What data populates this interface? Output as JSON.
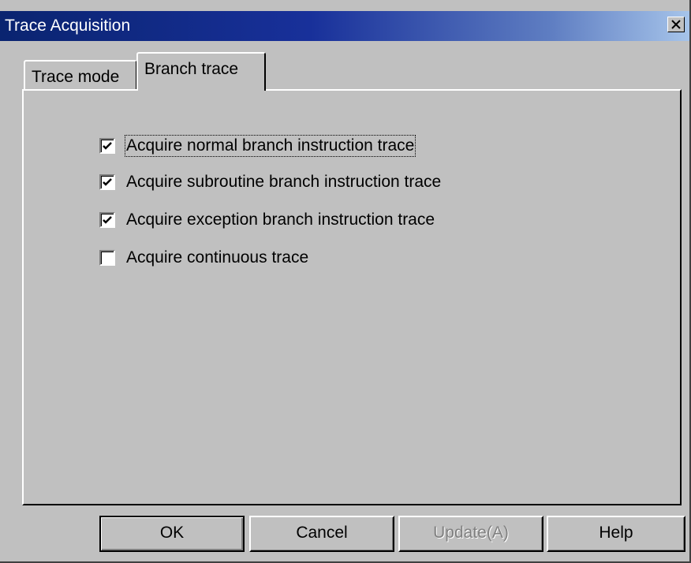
{
  "window": {
    "title": "Trace Acquisition",
    "close_icon": "close-icon"
  },
  "tabs": [
    {
      "label": "Trace mode",
      "active": false
    },
    {
      "label": "Branch trace",
      "active": true
    }
  ],
  "options": [
    {
      "label": "Acquire normal branch instruction trace",
      "checked": true
    },
    {
      "label": "Acquire subroutine branch instruction trace",
      "checked": true
    },
    {
      "label": "Acquire exception branch instruction trace",
      "checked": true
    },
    {
      "label": "Acquire continuous trace",
      "checked": false
    }
  ],
  "buttons": {
    "ok": "OK",
    "cancel": "Cancel",
    "update": "Update(A)",
    "help": "Help"
  }
}
